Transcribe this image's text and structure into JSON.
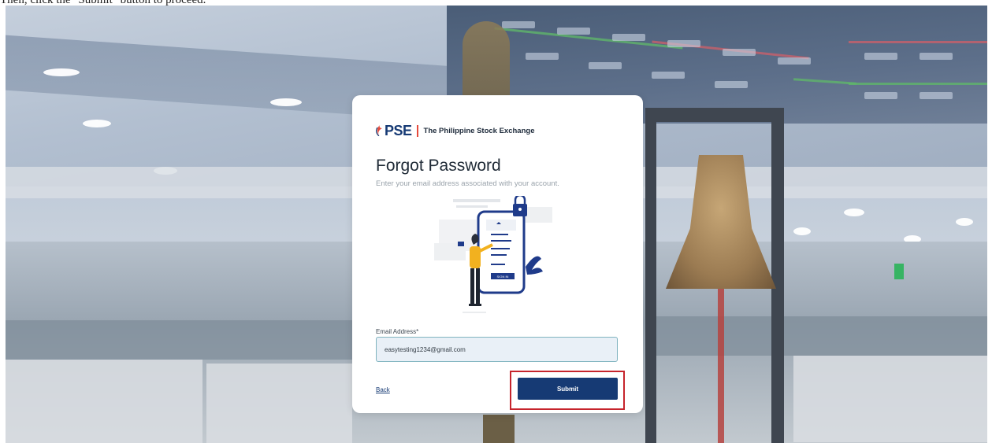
{
  "instruction_text": "Then, click the \"Submit\" button to proceed.",
  "brand": {
    "logo_text": "PSE",
    "name": "The Philippine Stock Exchange",
    "color": "#163a74",
    "accent": "#e54a3c"
  },
  "form": {
    "title": "Forgot Password",
    "subtitle": "Enter your email address associated with your account.",
    "email_label": "Email Address",
    "required_mark": "*",
    "email_value": "easytesting1234@gmail.com",
    "back_label": "Back",
    "submit_label": "Submit",
    "highlight_color": "#c6242c"
  },
  "illustration": {
    "phone_button_label": "SIGN IN"
  }
}
